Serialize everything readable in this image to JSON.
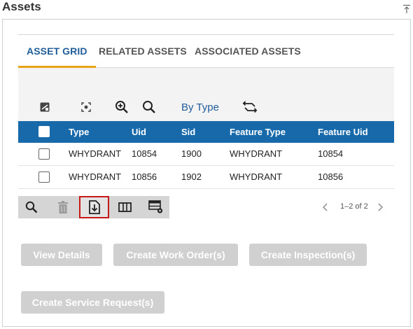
{
  "panel": {
    "title": "Assets"
  },
  "tabs": [
    {
      "label": "ASSET GRID",
      "active": true
    },
    {
      "label": "RELATED ASSETS",
      "active": false
    },
    {
      "label": "ASSOCIATED ASSETS",
      "active": false
    }
  ],
  "toolbar": {
    "by_type_label": "By Type"
  },
  "table": {
    "columns": [
      "Type",
      "Uid",
      "Sid",
      "Feature Type",
      "Feature Uid"
    ],
    "rows": [
      [
        "WHYDRANT",
        "10854",
        "1900",
        "WHYDRANT",
        "10854"
      ],
      [
        "WHYDRANT",
        "10856",
        "1902",
        "WHYDRANT",
        "10856"
      ]
    ]
  },
  "pager": {
    "text": "1–2 of 2"
  },
  "actions": {
    "view_details": "View Details",
    "create_work_order": "Create Work Order(s)",
    "create_inspection": "Create Inspection(s)",
    "create_service_request": "Create Service Request(s)"
  },
  "colors": {
    "accent": "#1f5c99",
    "header_bg": "#1769aa",
    "tab_underline": "#e8a317",
    "highlight_border": "#c71818",
    "disabled_button": "#d0d0d0"
  }
}
